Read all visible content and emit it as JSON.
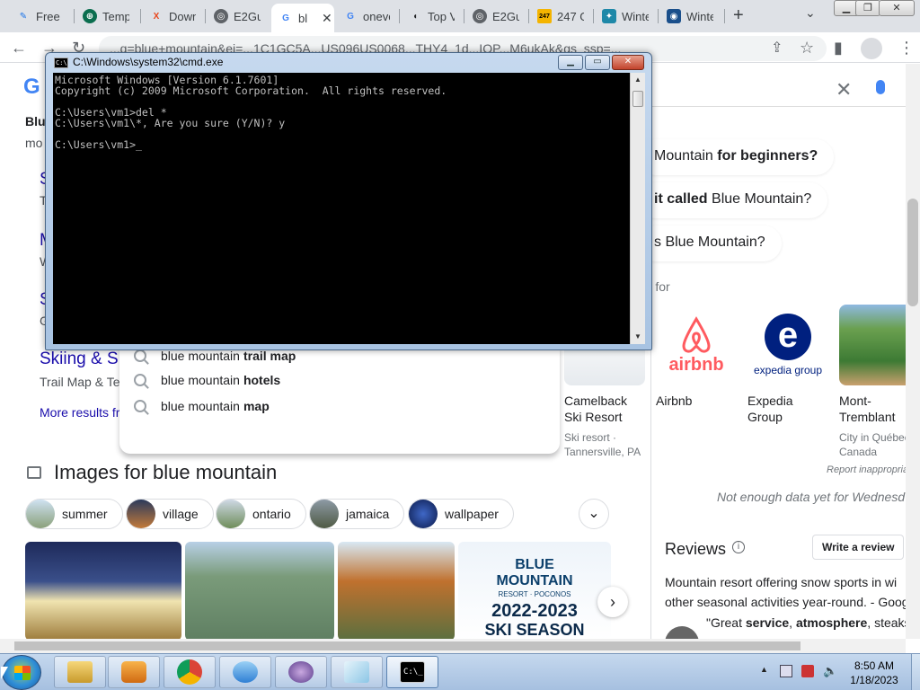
{
  "browser": {
    "tabs": [
      {
        "title": "Free P",
        "fav_color": "#1a73e8",
        "fav_glyph": "✎"
      },
      {
        "title": "Temp",
        "fav_color": "#0b6e4f",
        "fav_glyph": "⊕"
      },
      {
        "title": "Down",
        "fav_color": "#e8461c",
        "fav_glyph": "X"
      },
      {
        "title": "E2Gu",
        "fav_color": "#5f6368",
        "fav_glyph": "◎"
      },
      {
        "title": "bl",
        "fav_color": "#4285f4",
        "fav_glyph": "G"
      },
      {
        "title": "oneve",
        "fav_color": "#4285f4",
        "fav_glyph": "G"
      },
      {
        "title": "Top V",
        "fav_color": "#202124",
        "fav_glyph": "◖"
      },
      {
        "title": "E2Gu",
        "fav_color": "#5f6368",
        "fav_glyph": "◎"
      },
      {
        "title": "247 G",
        "fav_color": "#f4b400",
        "fav_glyph": "247"
      },
      {
        "title": "Winte",
        "fav_color": "#1e88a8",
        "fav_glyph": "✦"
      },
      {
        "title": "Winte",
        "fav_color": "#1a4f8b",
        "fav_glyph": "◉"
      }
    ],
    "new_tab": "+",
    "tab_close": "✕",
    "tab_search": "⌄",
    "omnibox_text": "...q=blue+mountain&ei=...1C1GC5A...US096US0068...THY4_1d...IOP...M6ukAk&gs_ssp=...",
    "back": "←",
    "forward": "→",
    "reload": "↻"
  },
  "search": {
    "logo_fragment": "G",
    "clear": "✕",
    "left_fragments": [
      "Blu",
      "mo",
      "S",
      "T",
      "M",
      "W",
      "S",
      "G"
    ],
    "skiing_link": "Skiing & S",
    "trail_fragment": "Trail Map & Te",
    "more_results": "More results fr",
    "paa": [
      {
        "pre": "Mountain ",
        "bold": "for beginners?"
      },
      {
        "pre": "",
        "bold": "it called ",
        "post": "Blue Mountain?"
      },
      {
        "pre": "s Blue Mountain?",
        "bold": ""
      }
    ],
    "people_search_for": "rch for",
    "cards": [
      {
        "name": "Camelback Ski Resort",
        "sub": "Ski resort · Tannersville, PA"
      },
      {
        "name": "Airbnb",
        "sub": ""
      },
      {
        "name": "Expedia Group",
        "sub": ""
      },
      {
        "name": "Mont-Tremblant",
        "sub": "City in Québec, Canada"
      }
    ],
    "airbnb_logo": "airbnb",
    "expedia_logo": "expedia group",
    "suggestions": [
      {
        "pre": "blue mountain",
        "bold": "trail map"
      },
      {
        "pre": "blue mountain",
        "bold": "hotels"
      },
      {
        "pre": "blue mountain",
        "bold": "map"
      }
    ],
    "images_heading": "Images for blue mountain",
    "chips": [
      "summer",
      "village",
      "ontario",
      "jamaica",
      "wallpaper"
    ],
    "chip_more": "⌄",
    "photo_next": "›",
    "ski_season": {
      "line1": "BLUE",
      "line2": "MOUNTAIN",
      "line3": "RESORT · POCONOS",
      "line4": "2022-2023",
      "line5": "SKI SEASON"
    },
    "report": "Report inappropria",
    "not_enough": "Not enough data yet for Wednesd",
    "reviews_title": "Reviews",
    "write_review": "Write a review",
    "review_desc_line1": "Mountain resort offering snow sports in wi",
    "review_desc_line2": "other seasonal activities year-round. - Goog",
    "review_quote_open": "\"Great ",
    "review_quote_b1": "service",
    "review_quote_mid": ", ",
    "review_quote_b2": "atmosphere",
    "review_quote_end": ", steaks c"
  },
  "cmd": {
    "title": "C:\\Windows\\system32\\cmd.exe",
    "lines": [
      "Microsoft Windows [Version 6.1.7601]",
      "Copyright (c) 2009 Microsoft Corporation.  All rights reserved.",
      "",
      "C:\\Users\\vm1>del *",
      "C:\\Users\\vm1\\*, Are you sure (Y/N)? y",
      "",
      "C:\\Users\\vm1>_"
    ],
    "minimize": "▁",
    "maximize": "▭",
    "close": "✕"
  },
  "taskbar": {
    "time": "8:50 AM",
    "date": "1/18/2023",
    "tray_arrow": "▲"
  }
}
